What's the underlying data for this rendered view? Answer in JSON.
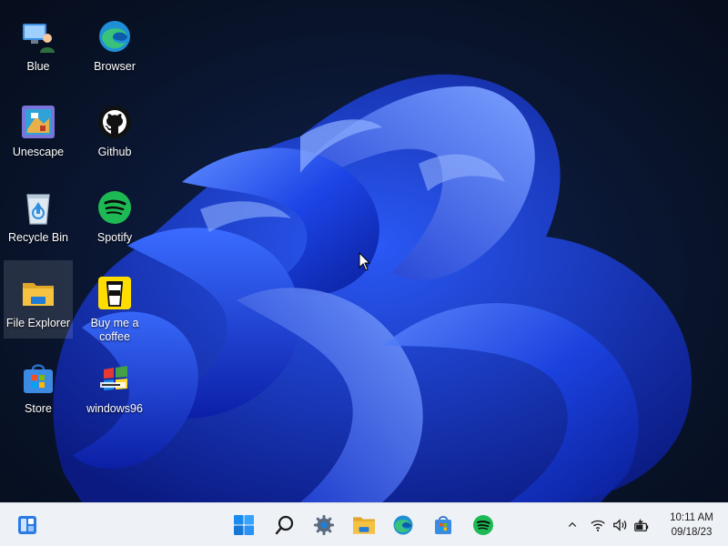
{
  "desktop": {
    "icons": [
      {
        "label": "Blue",
        "icon": "user-computer-icon"
      },
      {
        "label": "Browser",
        "icon": "edge-icon"
      },
      {
        "label": "Unescape",
        "icon": "unescape-icon"
      },
      {
        "label": "Github",
        "icon": "github-icon"
      },
      {
        "label": "Recycle Bin",
        "icon": "recycle-bin-icon"
      },
      {
        "label": "Spotify",
        "icon": "spotify-icon"
      },
      {
        "label": "File Explorer",
        "icon": "folder-icon"
      },
      {
        "label": "Buy me a coffee",
        "icon": "coffee-cup-icon"
      },
      {
        "label": "Store",
        "icon": "store-icon"
      },
      {
        "label": "windows96",
        "icon": "windows96-icon"
      }
    ]
  },
  "taskbar": {
    "widgets_icon": "widgets-icon",
    "apps": [
      "start-icon",
      "search-icon",
      "settings-gear-icon",
      "folder-icon",
      "edge-icon",
      "store-icon",
      "spotify-icon"
    ],
    "tray": [
      "chevron-up-icon",
      "wifi-icon",
      "volume-icon",
      "battery-icon"
    ],
    "clock": {
      "time": "10:11 AM",
      "date": "09/18/23"
    }
  },
  "colors": {
    "accent": "#0a64d8",
    "taskbar_bg": "#eef1f5",
    "spotify": "#1db954",
    "folder": "#f5c242"
  }
}
